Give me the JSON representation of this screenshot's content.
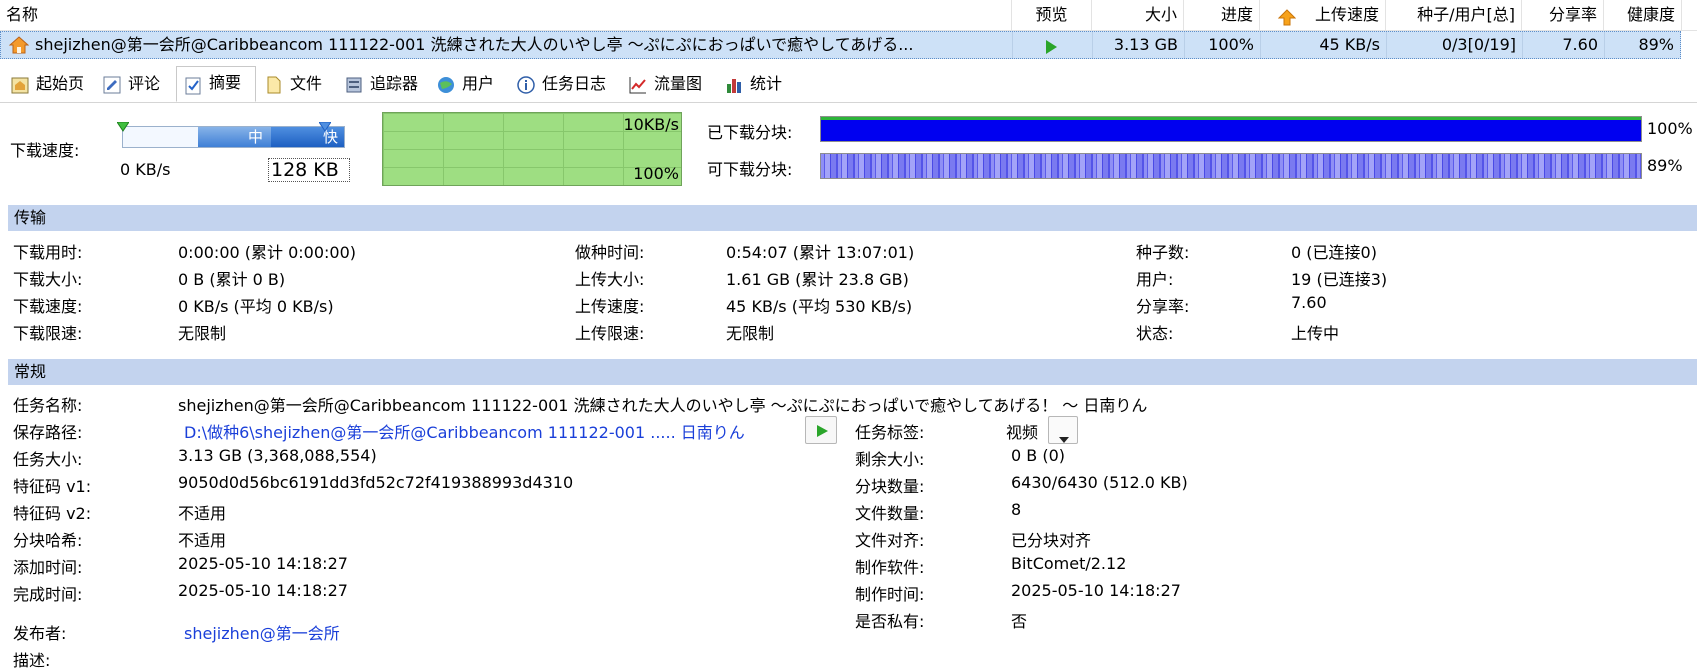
{
  "columns": {
    "name": "名称",
    "preview": "预览",
    "size": "大小",
    "progress": "进度",
    "upload_speed": "上传速度",
    "seeds_users": "种子/用户[总]",
    "share_ratio": "分享率",
    "health": "健康度"
  },
  "torrent": {
    "name": "shejizhen@第一会所@Caribbeancom 111122-001 洗練された大人のいやし亭 ～ぷにぷにおっぱいで癒やしてあげる...",
    "size": "3.13 GB",
    "progress": "100%",
    "upload_speed": "45 KB/s",
    "seeds_users": "0/3[0/19]",
    "share_ratio": "7.60",
    "health": "89%"
  },
  "tabs": [
    {
      "label": "起始页",
      "icon": "home-page-icon"
    },
    {
      "label": "评论",
      "icon": "comment-icon"
    },
    {
      "label": "摘要",
      "icon": "summary-icon",
      "active": true
    },
    {
      "label": "文件",
      "icon": "file-icon"
    },
    {
      "label": "追踪器",
      "icon": "tracker-icon"
    },
    {
      "label": "用户",
      "icon": "users-icon"
    },
    {
      "label": "任务日志",
      "icon": "info-icon"
    },
    {
      "label": "流量图",
      "icon": "traffic-chart-icon"
    },
    {
      "label": "统计",
      "icon": "statistics-icon"
    }
  ],
  "speed_panel": {
    "label": "下载速度:",
    "current": "0 KB/s",
    "limit_value": "128 KB",
    "slider_mid": "中",
    "slider_fast": "快",
    "graph_top": "10KB/s",
    "graph_bottom": "100%",
    "downloaded_label": "已下载分块:",
    "downloaded_pct": "100%",
    "downloaded_fraction": 1.0,
    "available_label": "可下载分块:",
    "available_pct": "89%",
    "available_fraction": 1.0
  },
  "transfer": {
    "title": "传输",
    "rows": [
      [
        {
          "k": "下载用时:",
          "v": "0:00:00 (累计 0:00:00)"
        },
        {
          "k": "做种时间:",
          "v": "0:54:07 (累计 13:07:01)"
        },
        {
          "k": "种子数:",
          "v": "0 (已连接0)"
        }
      ],
      [
        {
          "k": "下载大小:",
          "v": "0 B (累计 0 B)"
        },
        {
          "k": "上传大小:",
          "v": "1.61 GB (累计 23.8 GB)"
        },
        {
          "k": "用户:",
          "v": "19 (已连接3)"
        }
      ],
      [
        {
          "k": "下载速度:",
          "v": "0 KB/s (平均 0 KB/s)"
        },
        {
          "k": "上传速度:",
          "v": "45 KB/s (平均 530 KB/s)"
        },
        {
          "k": "分享率:",
          "v": "7.60"
        }
      ],
      [
        {
          "k": "下载限速:",
          "v": "无限制"
        },
        {
          "k": "上传限速:",
          "v": "无限制"
        },
        {
          "k": "状态:",
          "v": "上传中"
        }
      ]
    ]
  },
  "general": {
    "title": "常规",
    "task_name_label": "任务名称:",
    "task_name": "shejizhen@第一会所@Caribbeancom 111122-001 洗練された大人のいやし亭 ～ぷにぷにおっぱいで癒やしてあげる！ ～ 日南りん",
    "save_path_label": "保存路径:",
    "save_path": "D:\\做种6\\shejizhen@第一会所@Caribbeancom 111122-001 ..... 日南りん",
    "left": [
      {
        "k": "任务大小:",
        "v": "3.13 GB (3,368,088,554)"
      },
      {
        "k": "特征码 v1:",
        "v": "9050d0d56bc6191dd3fd52c72f419388993d4310"
      },
      {
        "k": "特征码 v2:",
        "v": "不适用"
      },
      {
        "k": "分块哈希:",
        "v": "不适用"
      },
      {
        "k": "添加时间:",
        "v": "2025-05-10 14:18:27"
      },
      {
        "k": "完成时间:",
        "v": "2025-05-10 14:18:27"
      }
    ],
    "publisher_label": "发布者:",
    "publisher": "shejizhen@第一会所",
    "description_label": "描述:",
    "task_tag_label": "任务标签:",
    "task_tag": "视频",
    "right": [
      {
        "k": "剩余大小:",
        "v": "0 B (0)"
      },
      {
        "k": "分块数量:",
        "v": "6430/6430 (512.0 KB)"
      },
      {
        "k": "文件数量:",
        "v": "8"
      },
      {
        "k": "文件对齐:",
        "v": "已分块对齐"
      },
      {
        "k": "制作软件:",
        "v": "BitComet/2.12"
      },
      {
        "k": "制作时间:",
        "v": "2025-05-10 14:18:27"
      },
      {
        "k": "是否私有:",
        "v": "否"
      }
    ]
  },
  "colors": {
    "selected_row": "#cde1f7",
    "section_header": "#c3d3ee",
    "progress_blue": "#0000f0",
    "graph_green": "#9ede82",
    "link_blue": "#1a3fd9"
  }
}
